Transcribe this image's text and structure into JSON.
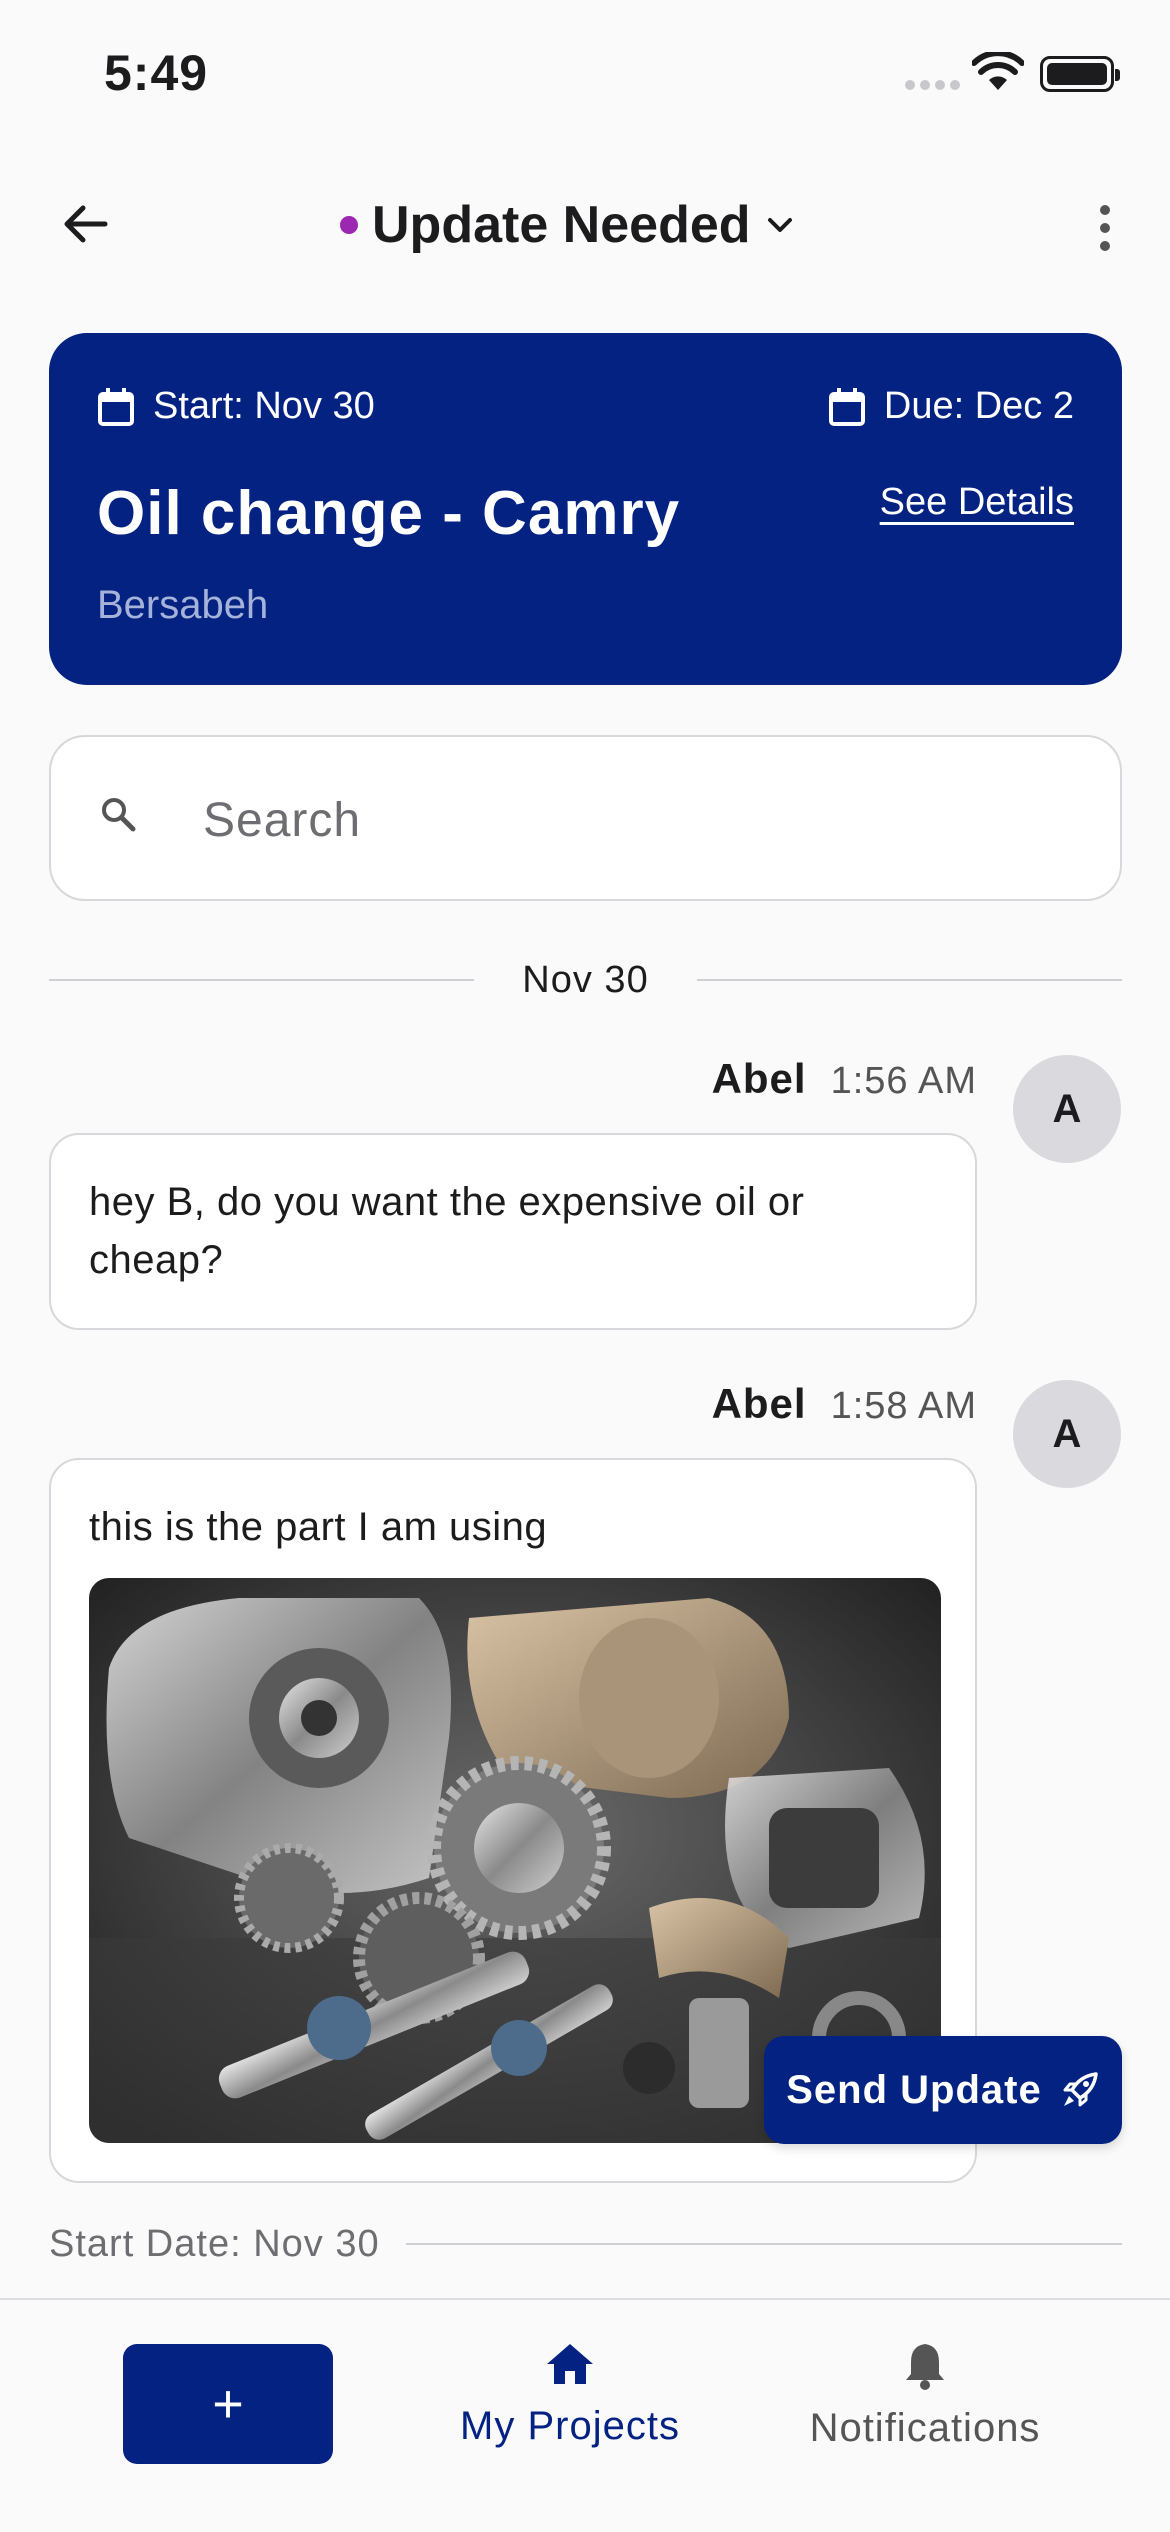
{
  "status_bar": {
    "time": "5:49"
  },
  "header": {
    "status_label": "Update Needed",
    "status_color": "#9c27b0"
  },
  "project": {
    "start_label": "Start: Nov 30",
    "due_label": "Due: Dec 2",
    "title": "Oil change - Camry",
    "details_link": "See Details",
    "customer": "Bersabeh",
    "card_color": "#042281"
  },
  "search": {
    "placeholder": "Search"
  },
  "feed": {
    "date_divider": "Nov 30",
    "messages": [
      {
        "author": "Abel",
        "time": "1:56 AM",
        "avatar": "A",
        "text": "hey B, do you want the expensive oil or cheap?"
      },
      {
        "author": "Abel",
        "time": "1:58 AM",
        "avatar": "A",
        "text": "this is the part I am using",
        "image": "car-parts-photo"
      }
    ],
    "start_date_label": "Start Date: Nov 30"
  },
  "send_update": {
    "label": "Send Update",
    "icon": "rocket-icon"
  },
  "bottom_nav": {
    "add_label": "+",
    "items": [
      {
        "label": "My Projects",
        "icon": "home-icon",
        "active": true
      },
      {
        "label": "Notifications",
        "icon": "bell-icon",
        "active": false
      }
    ]
  }
}
